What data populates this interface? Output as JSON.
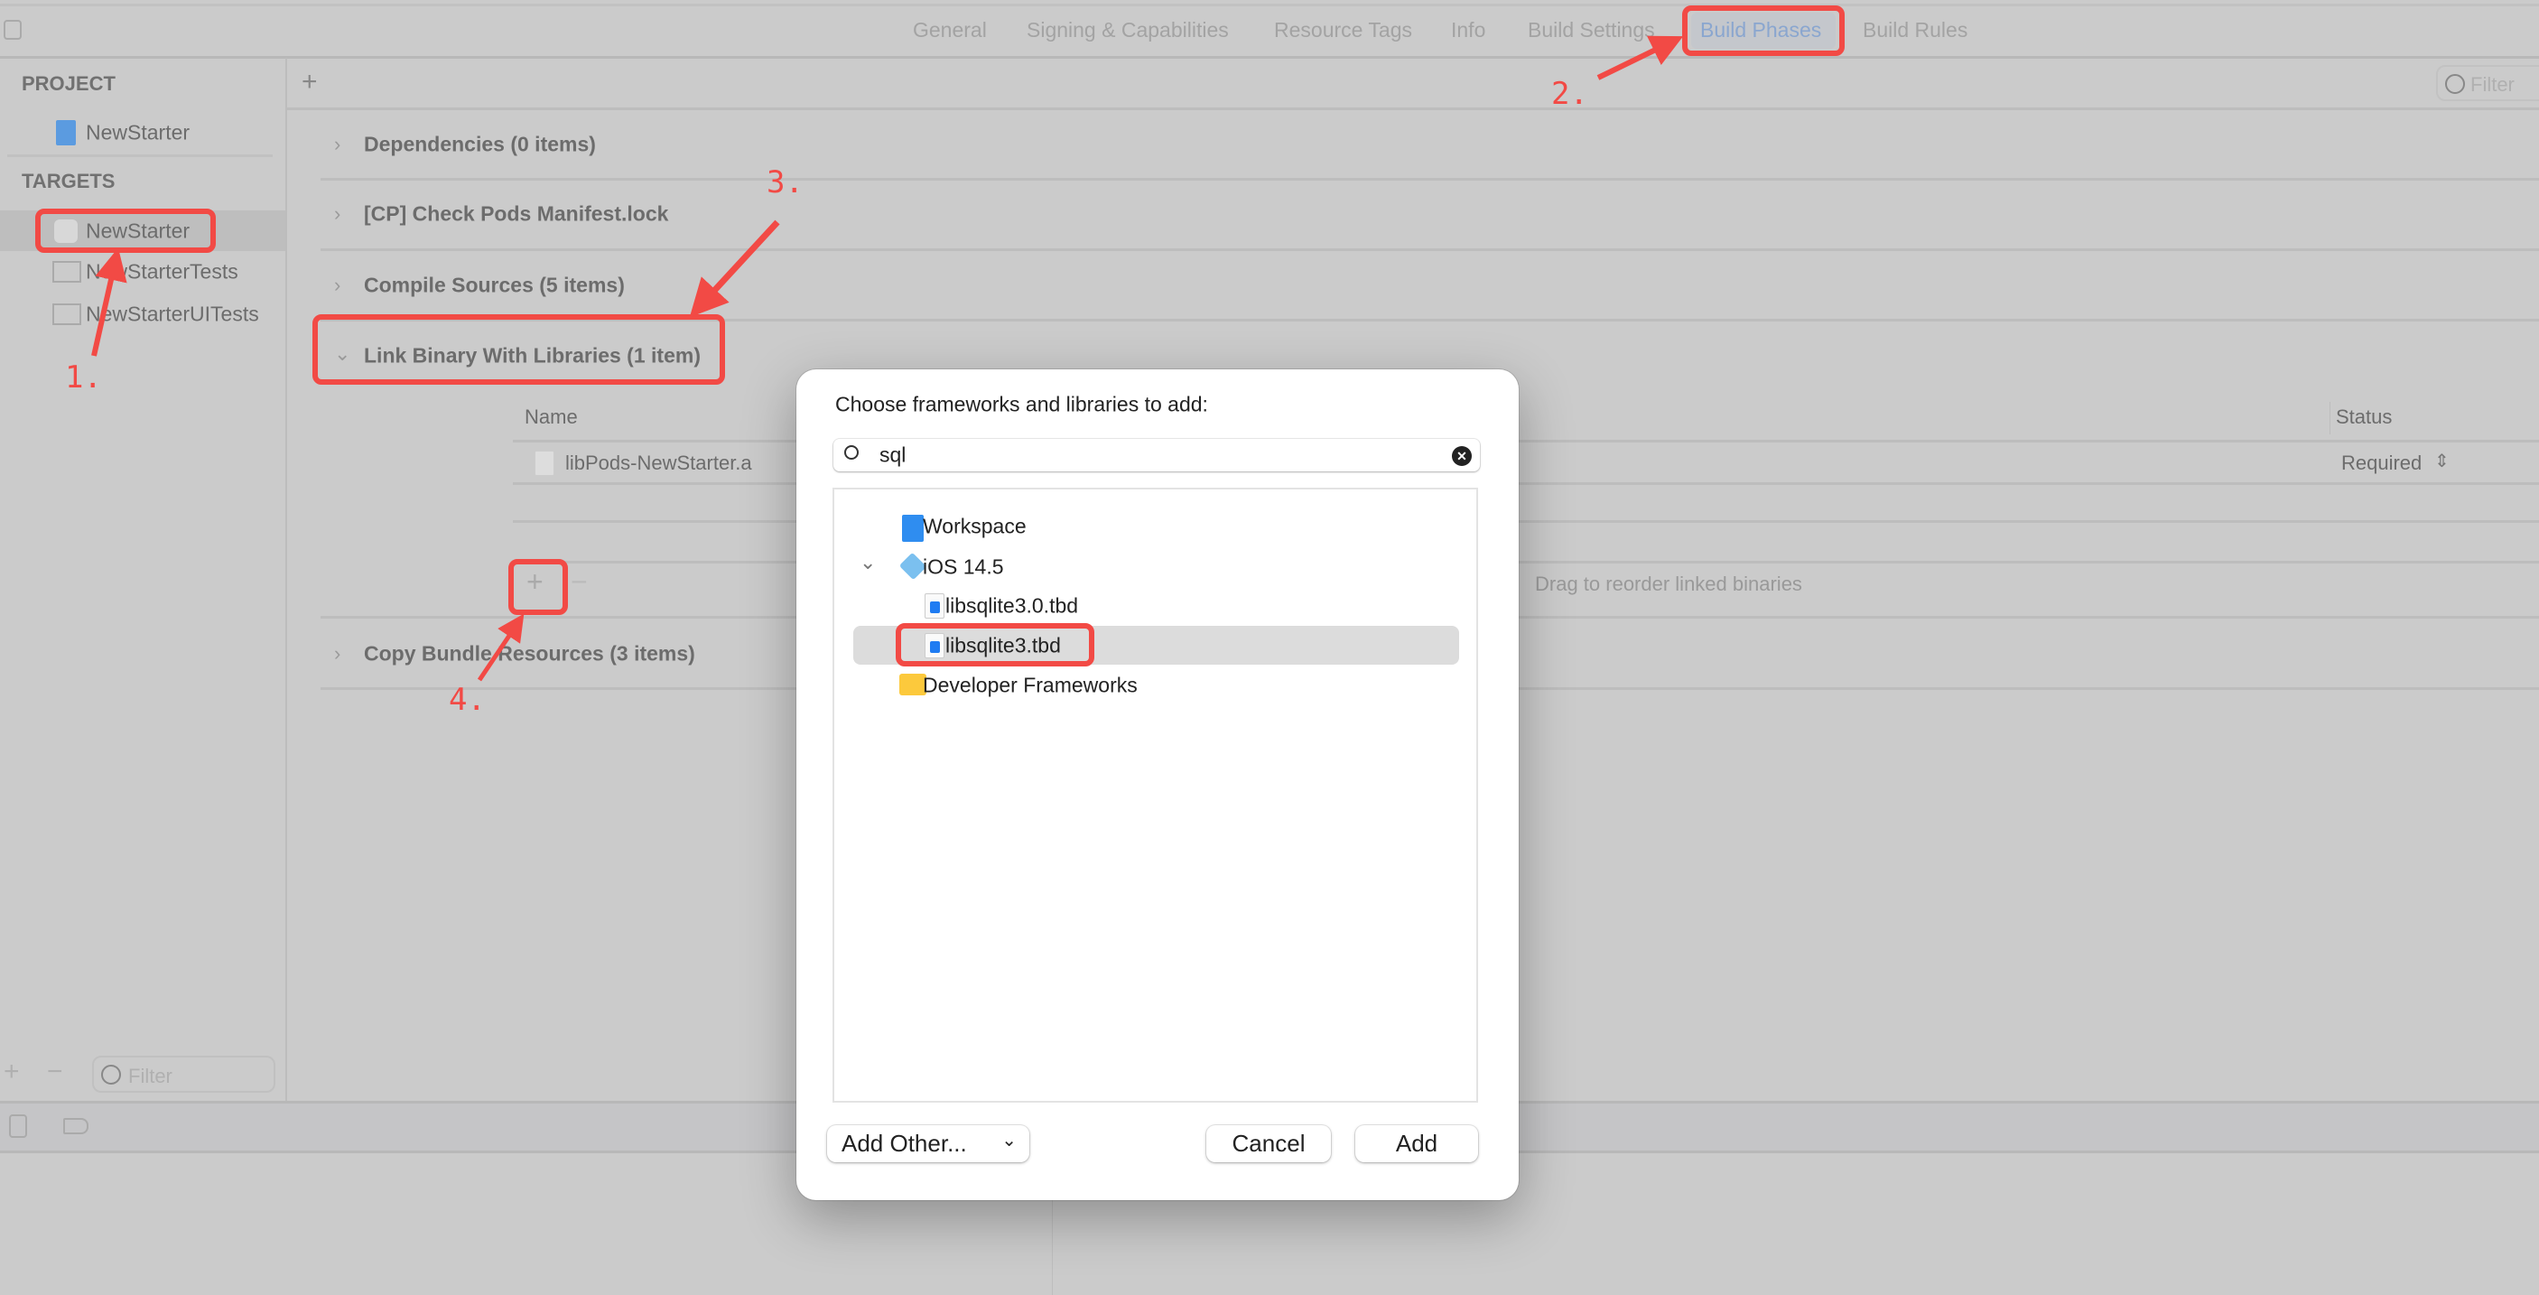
{
  "tabs": [
    "General",
    "Signing & Capabilities",
    "Resource Tags",
    "Info",
    "Build Settings",
    "Build Phases",
    "Build Rules"
  ],
  "active_tab": "Build Phases",
  "sidebar": {
    "project_header": "PROJECT",
    "project": "NewStarter",
    "targets_header": "TARGETS",
    "targets": [
      "NewStarter",
      "NewStarterTests",
      "NewStarterUITests"
    ],
    "selected_target": "NewStarter",
    "filter_placeholder": "Filter"
  },
  "main": {
    "filter_placeholder": "Filter",
    "phases": [
      "Dependencies (0 items)",
      "[CP] Check Pods Manifest.lock",
      "Compile Sources (5 items)",
      "Link Binary With Libraries (1 item)",
      "Copy Bundle Resources (3 items)"
    ],
    "table": {
      "columns": [
        "Name",
        "Status"
      ],
      "rows": [
        {
          "name": "libPods-NewStarter.a",
          "status": "Required"
        }
      ],
      "hint": "Drag to reorder linked binaries"
    }
  },
  "dialog": {
    "title": "Choose frameworks and libraries to add:",
    "search_value": "sql",
    "tree": [
      {
        "label": "Workspace",
        "icon": "xcode-workspace-icon"
      },
      {
        "label": "iOS 14.5",
        "icon": "sdk-icon",
        "expanded": true
      },
      {
        "label": "libsqlite3.0.tbd",
        "icon": "tbd-file-icon"
      },
      {
        "label": "libsqlite3.tbd",
        "icon": "tbd-file-icon",
        "selected": true
      },
      {
        "label": "Developer Frameworks",
        "icon": "folder-icon"
      }
    ],
    "add_other": "Add Other...",
    "cancel": "Cancel",
    "add": "Add"
  },
  "annotations": [
    "1.",
    "2.",
    "3.",
    "4."
  ],
  "colors": {
    "annotation": "#f24a45",
    "active_tab": "#8aa6cf",
    "background": "#cbcbcb"
  }
}
